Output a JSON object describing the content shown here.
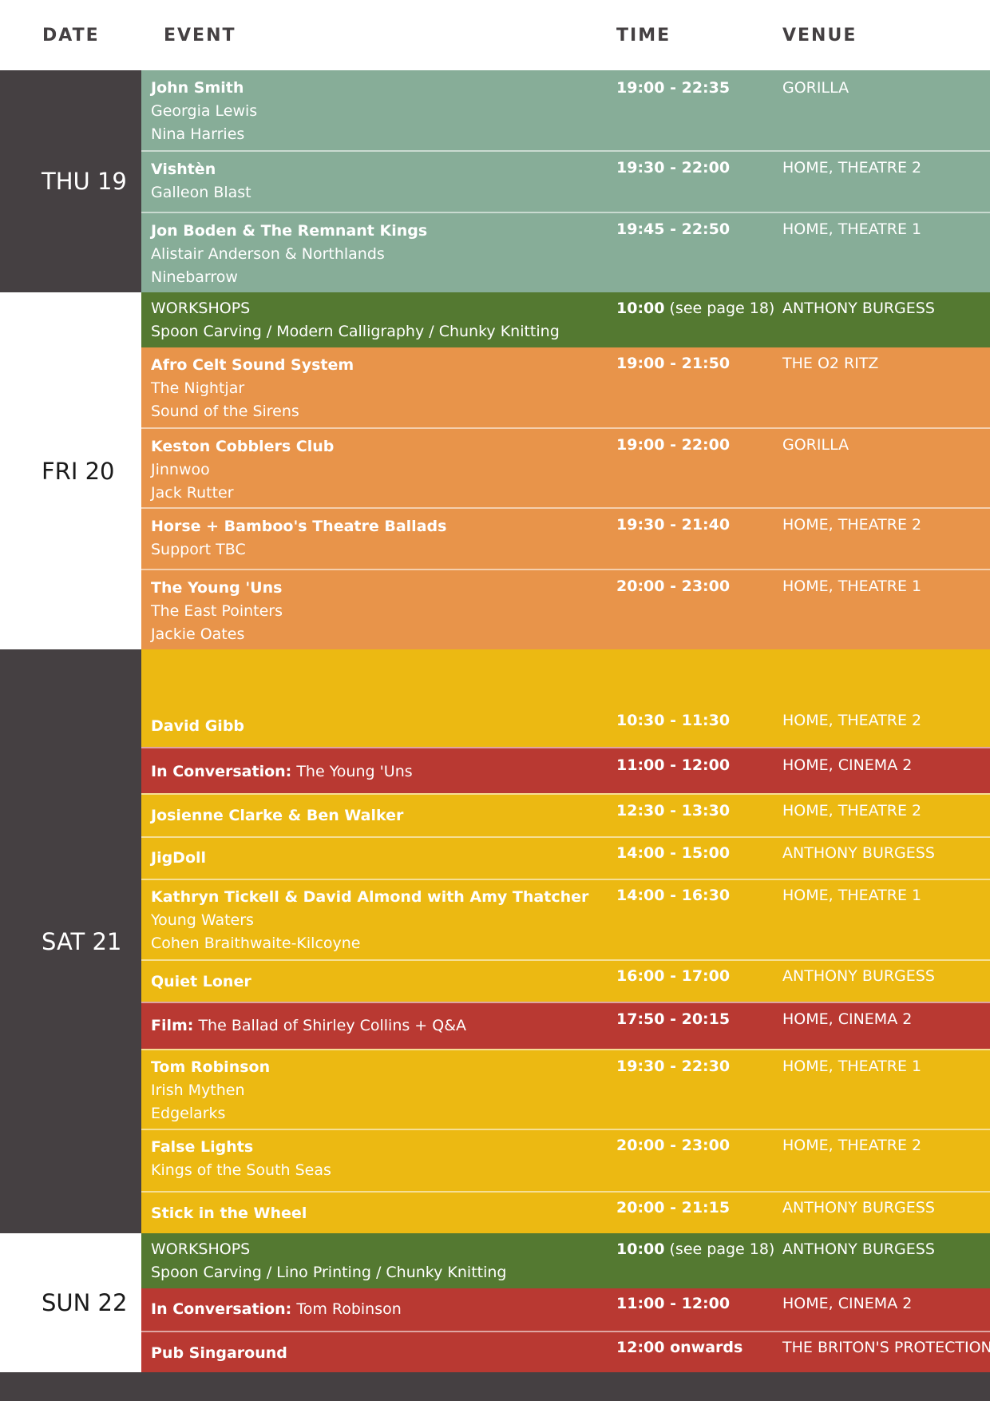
{
  "headers": {
    "date": "DATE",
    "event": "EVENT",
    "time": "TIME",
    "venue": "VENUE"
  },
  "colors": {
    "dark": "#454042",
    "teal": "#87ad98",
    "green": "#547931",
    "orange": "#e8944a",
    "yellow": "#ecb912",
    "red": "#b93932"
  },
  "days": [
    {
      "label": "THU 19"
    },
    {
      "label": "FRI 20"
    },
    {
      "label": "SAT 21"
    },
    {
      "label": "SUN 22"
    }
  ],
  "rows": [
    {
      "lead": "John Smith",
      "main": "",
      "lines": [
        "Georgia Lewis",
        "Nina Harries"
      ],
      "time": "19:00 - 22:35",
      "note": "",
      "venue": "GORILLA"
    },
    {
      "lead": "Vishtèn",
      "main": "",
      "lines": [
        "Galleon Blast"
      ],
      "time": "19:30 - 22:00",
      "note": "",
      "venue": "HOME, THEATRE 2"
    },
    {
      "lead": "Jon Boden & The Remnant Kings",
      "main": "",
      "lines": [
        "Alistair Anderson & Northlands",
        "Ninebarrow"
      ],
      "time": "19:45 - 22:50",
      "note": "",
      "venue": "HOME, THEATRE 1"
    },
    {
      "lead": "",
      "main": "WORKSHOPS",
      "lines": [
        "Spoon Carving / Modern Calligraphy / Chunky Knitting"
      ],
      "time": "10:00",
      "note": " (see page 18)",
      "venue": "ANTHONY BURGESS"
    },
    {
      "lead": "Afro Celt Sound System",
      "main": "",
      "lines": [
        "The Nightjar",
        "Sound  of the Sirens"
      ],
      "time": "19:00 - 21:50",
      "note": "",
      "venue": "THE O2 RITZ"
    },
    {
      "lead": "Keston Cobblers Club",
      "main": "",
      "lines": [
        "Jinnwoo",
        "Jack Rutter"
      ],
      "time": "19:00 - 22:00",
      "note": "",
      "venue": "GORILLA"
    },
    {
      "lead": "Horse + Bamboo's Theatre Ballads",
      "main": "",
      "lines": [
        "Support TBC"
      ],
      "time": "19:30 - 21:40",
      "note": "",
      "venue": "HOME, THEATRE 2"
    },
    {
      "lead": "The Young 'Uns",
      "main": "",
      "lines": [
        "The East Pointers",
        "Jackie Oates"
      ],
      "time": "20:00 - 23:00",
      "note": "",
      "venue": "HOME, THEATRE 1"
    },
    {
      "lead": "David Gibb",
      "main": "",
      "lines": [],
      "time": "10:30 - 11:30",
      "note": "",
      "venue": "HOME, THEATRE 2"
    },
    {
      "lead": "In Conversation:",
      "main": " The Young 'Uns",
      "lines": [],
      "time": "11:00 - 12:00",
      "note": "",
      "venue": "HOME, CINEMA 2"
    },
    {
      "lead": "Josienne Clarke & Ben Walker",
      "main": "",
      "lines": [],
      "time": "12:30 - 13:30",
      "note": "",
      "venue": "HOME, THEATRE 2"
    },
    {
      "lead": "JigDoll",
      "main": "",
      "lines": [],
      "time": "14:00 - 15:00",
      "note": "",
      "venue": "ANTHONY BURGESS"
    },
    {
      "lead": "Kathryn Tickell & David Almond with Amy Thatcher",
      "main": "",
      "lines": [
        "Young Waters",
        "Cohen Braithwaite-Kilcoyne"
      ],
      "time": "14:00 - 16:30",
      "note": "",
      "venue": "HOME, THEATRE 1"
    },
    {
      "lead": "Quiet Loner",
      "main": "",
      "lines": [],
      "time": "16:00 - 17:00",
      "note": "",
      "venue": "ANTHONY BURGESS"
    },
    {
      "lead": "Film:",
      "main": " The Ballad of Shirley Collins + Q&A",
      "lines": [],
      "time": "17:50 - 20:15",
      "note": "",
      "venue": "HOME, CINEMA 2"
    },
    {
      "lead": "Tom Robinson",
      "main": "",
      "lines": [
        "Irish Mythen",
        "Edgelarks"
      ],
      "time": "19:30 - 22:30",
      "note": "",
      "venue": "HOME, THEATRE 1"
    },
    {
      "lead": "False Lights",
      "main": "",
      "lines": [
        "Kings of the South Seas"
      ],
      "time": "20:00 - 23:00",
      "note": "",
      "venue": "HOME, THEATRE 2"
    },
    {
      "lead": "Stick in the Wheel",
      "main": "",
      "lines": [],
      "time": "20:00 - 21:15",
      "note": "",
      "venue": "ANTHONY BURGESS"
    },
    {
      "lead": "",
      "main": "WORKSHOPS",
      "lines": [
        "Spoon Carving / Lino Printing / Chunky Knitting"
      ],
      "time": "10:00",
      "note": " (see page 18)",
      "venue": "ANTHONY BURGESS"
    },
    {
      "lead": "In Conversation:",
      "main": " Tom Robinson",
      "lines": [],
      "time": "11:00 - 12:00",
      "note": "",
      "venue": "HOME, CINEMA 2"
    },
    {
      "lead": "Pub Singaround",
      "main": "",
      "lines": [],
      "time": "12:00 onwards",
      "note": "",
      "venue": "THE BRITON'S PROTECTION"
    }
  ]
}
